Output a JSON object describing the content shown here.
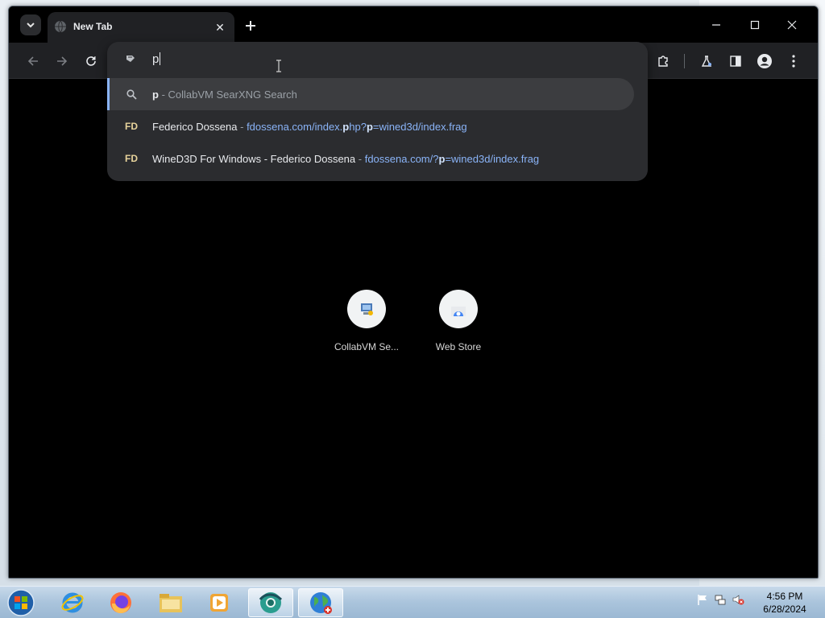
{
  "browser": {
    "tab": {
      "title": "New Tab",
      "close_glyph": "✕"
    },
    "new_tab_glyph": "+",
    "window_controls": {
      "minimize": "—",
      "maximize": "☐",
      "close": "✕"
    },
    "toolbar": {
      "back_icon": "arrow-left-icon",
      "forward_icon": "arrow-right-icon",
      "reload_icon": "reload-icon"
    }
  },
  "omnibox": {
    "input_value": "p",
    "suggestions": [
      {
        "type": "search",
        "icon": "search-icon",
        "query": "p",
        "separator": " - ",
        "desc": "CollabVM SearXNG Search"
      },
      {
        "type": "history",
        "icon_text": "FD",
        "title": "Federico Dossena",
        "separator": " - ",
        "url_pre": "fdossena.com/index.",
        "url_b1": "p",
        "url_mid": "hp?",
        "url_b2": "p",
        "url_post": "=wined3d/index.frag"
      },
      {
        "type": "history",
        "icon_text": "FD",
        "title": "WineD3D For Windows - Federico Dossena",
        "separator": " - ",
        "url_pre": "fdossena.com/?",
        "url_b1": "p",
        "url_post": "=wined3d/index.frag"
      }
    ]
  },
  "shortcuts": [
    {
      "label": "CollabVM Se...",
      "icon": "collabvm-icon"
    },
    {
      "label": "Web Store",
      "icon": "web-store-icon"
    }
  ],
  "taskbar": {
    "apps": [
      "internet-explorer-icon",
      "firefox-icon",
      "file-explorer-icon",
      "media-player-icon",
      "chrome-dev-icon",
      "globe-icon"
    ],
    "clock": {
      "time": "4:56 PM",
      "date": "6/28/2024"
    }
  },
  "colors": {
    "accent": "#8ab4f8",
    "omnibox_bg": "#2b2c2f",
    "page_bg": "#000000"
  }
}
